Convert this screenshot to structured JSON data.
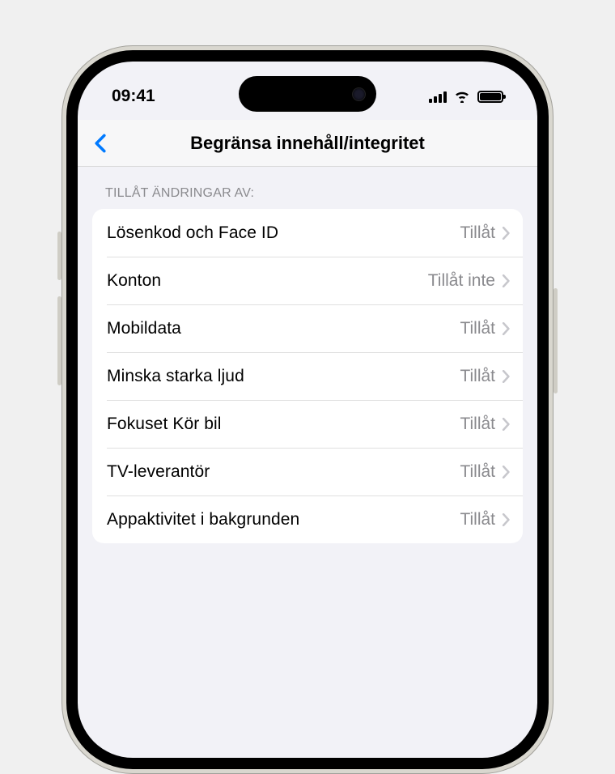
{
  "status": {
    "time": "09:41"
  },
  "nav": {
    "title": "Begränsa innehåll/integritet"
  },
  "section": {
    "header": "TILLÅT ÄNDRINGAR AV:"
  },
  "rows": [
    {
      "label": "Lösenkod och Face ID",
      "value": "Tillåt"
    },
    {
      "label": "Konton",
      "value": "Tillåt inte"
    },
    {
      "label": "Mobildata",
      "value": "Tillåt"
    },
    {
      "label": "Minska starka ljud",
      "value": "Tillåt"
    },
    {
      "label": "Fokuset Kör bil",
      "value": "Tillåt"
    },
    {
      "label": "TV-leverantör",
      "value": "Tillåt"
    },
    {
      "label": "Appaktivitet i bakgrunden",
      "value": "Tillåt"
    }
  ]
}
